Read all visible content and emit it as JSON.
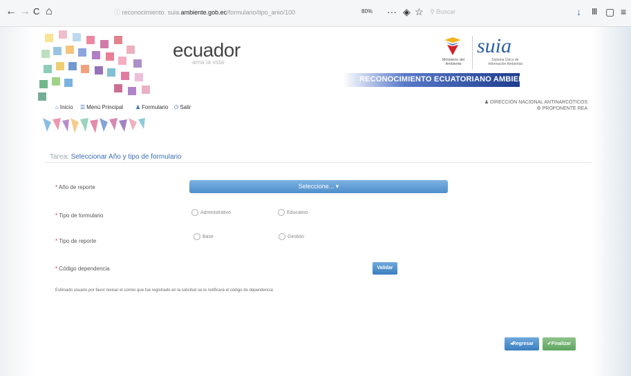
{
  "browser": {
    "back": "←",
    "forward": "→",
    "reload": "C",
    "home": "⌂",
    "url_prefix": "reconocimiento. suia.",
    "url_domain": "ambiente.gob.ec",
    "url_suffix": "/formulario/tipo_anio/100",
    "zoom": "80%",
    "more": "···",
    "pocket": "◈",
    "bookmark": "☆",
    "search_placeholder": "Buscar",
    "download": "↓",
    "library": "Ⅲ",
    "sidebar": "▢",
    "menu": "≡"
  },
  "header": {
    "title": "ecuador",
    "subtitle": "ama la vida",
    "ministry": "Ministerio del Ambiente",
    "suia": "suia",
    "suia_sub": "Sistema Único de Información Ambiental",
    "banner": "RECONOCIMIENTO ECUATORIANO AMBIENTAL"
  },
  "menu": {
    "items": [
      {
        "icon": "⌂",
        "label": "Inicio"
      },
      {
        "icon": "☰",
        "label": "Menú Principal"
      },
      {
        "icon": "♟",
        "label": "Formulario"
      },
      {
        "icon": "⏻",
        "label": "Salir"
      }
    ]
  },
  "user": {
    "org": "DIRECCIÓN NACIONAL ANTINARCÓTICOS",
    "role": "PROPONENTE REA"
  },
  "task": {
    "prefix": "Tarea: ",
    "title": "Seleccionar Año y tipo de formulario"
  },
  "form": {
    "year_label": "Año de reporte",
    "year_select": "Seleccione...",
    "form_type_label": "Tipo de formulario",
    "form_type_options": [
      "Administrativo",
      "Educativo"
    ],
    "report_type_label": "Tipo de reporte",
    "report_type_options": [
      "Base",
      "Gestión"
    ],
    "dependency_label": "Código dependencia",
    "validate_button": "Validar",
    "notice": "Estimado usuario por favor revisar el correo que fue registrado en la solicitud se le notificará el código de dependencia",
    "back_button": "Regresar",
    "finish_button": "Finalizar"
  },
  "colors": {
    "primary": "#4e8ecb",
    "banner": "#1e3d8f",
    "finish": "#5ea55e"
  }
}
